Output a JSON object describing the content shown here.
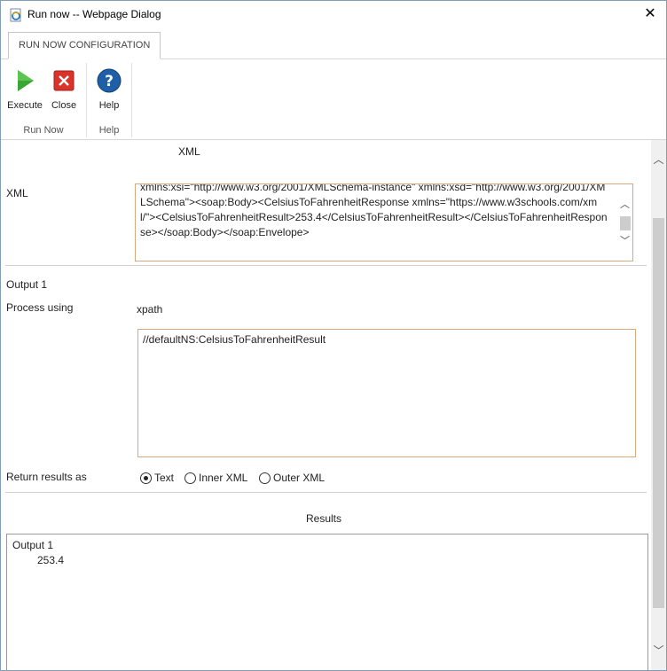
{
  "window": {
    "title": "Run now -- Webpage Dialog",
    "close_glyph": "✕"
  },
  "ribbon": {
    "tab_label": "RUN NOW CONFIGURATION",
    "groups": [
      {
        "label": "Run Now",
        "buttons": [
          {
            "label": "Execute",
            "icon": "play-icon"
          },
          {
            "label": "Close",
            "icon": "close-red-icon"
          }
        ]
      },
      {
        "label": "Help",
        "buttons": [
          {
            "label": "Help",
            "icon": "help-icon"
          }
        ]
      }
    ]
  },
  "form": {
    "xml_section_header": "XML",
    "xml_label": "XML",
    "xml_value": "xmlns:xsi=\"http://www.w3.org/2001/XMLSchema-instance\" xmlns:xsd=\"http://www.w3.org/2001/XMLSchema\"><soap:Body><CelsiusToFahrenheitResponse xmlns=\"https://www.w3schools.com/xml/\"><CelsiusToFahrenheitResult>253.4</CelsiusToFahrenheitResult></CelsiusToFahrenheitResponse></soap:Body></soap:Envelope>",
    "output_label": "Output 1",
    "process_using_label": "Process using",
    "process_using_value": "xpath",
    "xpath_value": "//defaultNS:CelsiusToFahrenheitResult",
    "return_results_label": "Return results as",
    "return_options": [
      {
        "label": "Text",
        "selected": true
      },
      {
        "label": "Inner XML",
        "selected": false
      },
      {
        "label": "Outer XML",
        "selected": false
      }
    ]
  },
  "results": {
    "header": "Results",
    "output_name": "Output 1",
    "output_value": "253.4"
  },
  "colors": {
    "field_border": "#d9a87c",
    "accent_blue": "#1e5fa8",
    "play_green": "#3aa635",
    "close_red": "#d9342b"
  }
}
